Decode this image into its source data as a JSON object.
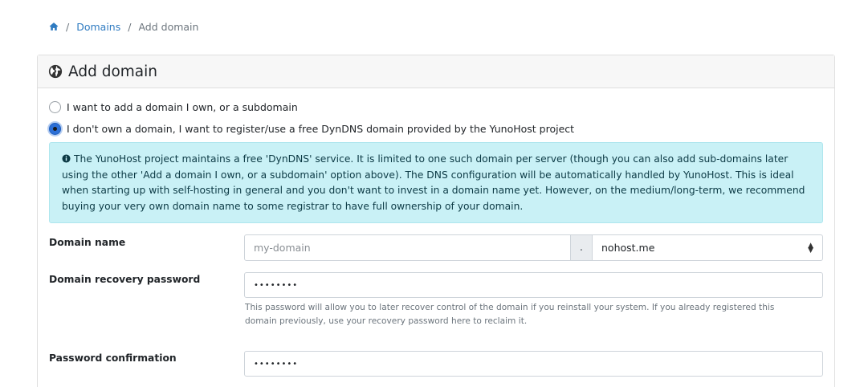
{
  "breadcrumb": {
    "home_icon": "home-icon",
    "separator": "/",
    "domains": "Domains",
    "current": "Add domain"
  },
  "card": {
    "icon": "globe-icon",
    "title": "Add domain"
  },
  "options": {
    "own_domain": "I want to add a domain I own, or a subdomain",
    "dyndns": "I don't own a domain, I want to register/use a free DynDNS domain provided by the YunoHost project",
    "selected": "dyndns"
  },
  "alert": {
    "icon": "info-circle-icon",
    "text": "The YunoHost project maintains a free 'DynDNS' service. It is limited to one such domain per server (though you can also add sub-domains later using the other 'Add a domain I own, or a subdomain' option above). The DNS configuration will be automatically handled by YunoHost. This is ideal when starting up with self-hosting in general and you don't want to invest in a domain name yet. However, on the medium/long-term, we recommend buying your very own domain name to some registrar to have full ownership of your domain."
  },
  "form": {
    "domain_label": "Domain name",
    "domain_placeholder": "my-domain",
    "domain_dot": ".",
    "domain_suffix": "nohost.me",
    "recovery_label": "Domain recovery password",
    "recovery_value": "••••••••",
    "recovery_help": "This password will allow you to later recover control of the domain if you reinstall your system. If you already registered this domain previously, use your recovery password here to reclaim it.",
    "confirm_label": "Password confirmation",
    "confirm_value": "••••••••"
  },
  "colors": {
    "link": "#2f7bc1",
    "alert_bg": "#c9f1f6",
    "radio_checked": "#2c6fd6"
  }
}
